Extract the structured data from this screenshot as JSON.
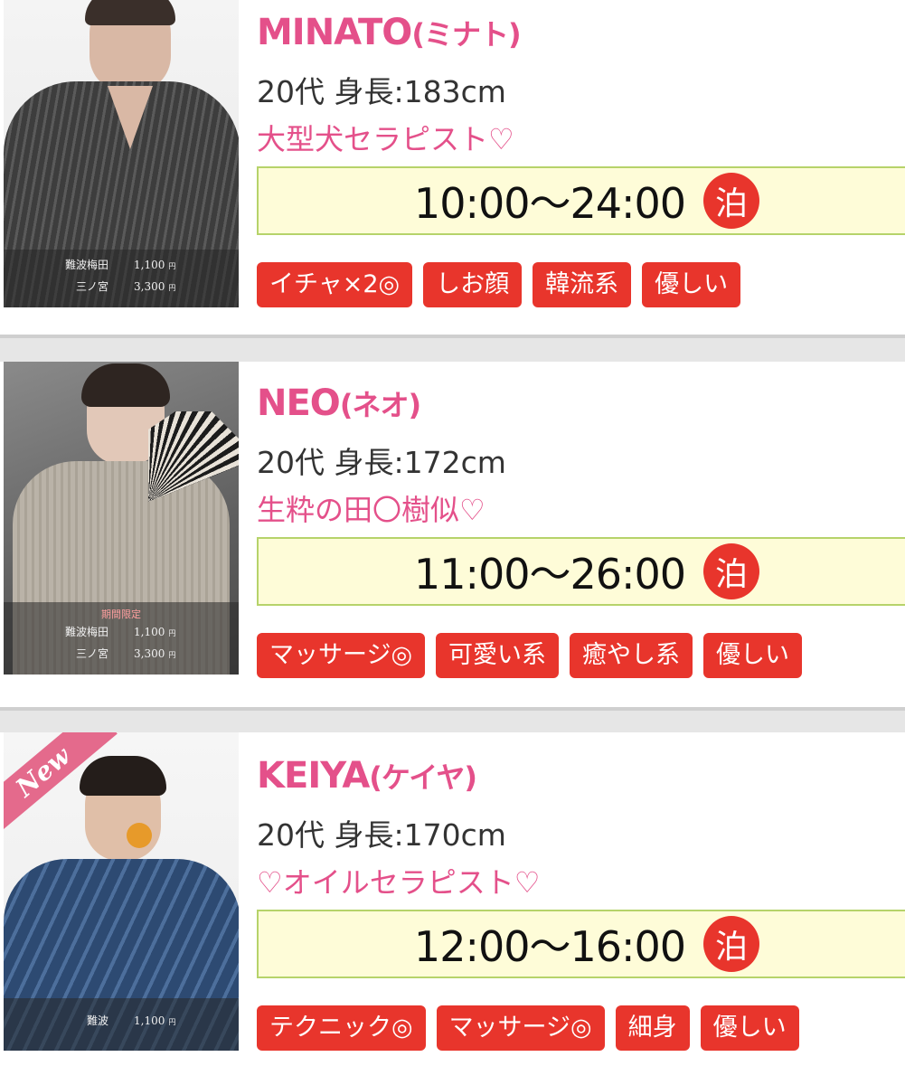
{
  "therapists": [
    {
      "name_en": "MINATO",
      "name_kana": "(ミナト)",
      "age_height": "20代 身長:183cm",
      "catchphrase": "大型犬セラピスト♡",
      "hours": "10:00〜24:00",
      "stay_badge": "泊",
      "tags": [
        "イチャ×2◎",
        "しお顔",
        "韓流系",
        "優しい"
      ],
      "limited": "",
      "prices": [
        {
          "area": "難波梅田",
          "amount": "1,100",
          "unit": "円"
        },
        {
          "area": "三ノ宮",
          "amount": "3,300",
          "unit": "円"
        }
      ],
      "new_ribbon": ""
    },
    {
      "name_en": "NEO",
      "name_kana": "(ネオ)",
      "age_height": "20代 身長:172cm",
      "catchphrase": "生粋の田〇樹似♡",
      "hours": "11:00〜26:00",
      "stay_badge": "泊",
      "tags": [
        "マッサージ◎",
        "可愛い系",
        "癒やし系",
        "優しい"
      ],
      "limited": "期間限定",
      "prices": [
        {
          "area": "難波梅田",
          "amount": "1,100",
          "unit": "円"
        },
        {
          "area": "三ノ宮",
          "amount": "3,300",
          "unit": "円"
        }
      ],
      "new_ribbon": ""
    },
    {
      "name_en": "KEIYA",
      "name_kana": "(ケイヤ)",
      "age_height": "20代 身長:170cm",
      "catchphrase": "♡オイルセラピスト♡",
      "hours": "12:00〜16:00",
      "stay_badge": "泊",
      "tags": [
        "テクニック◎",
        "マッサージ◎",
        "細身",
        "優しい"
      ],
      "limited": "",
      "prices": [
        {
          "area": "難波",
          "amount": "1,100",
          "unit": "円"
        }
      ],
      "new_ribbon": "New"
    }
  ],
  "colors": {
    "name_pink": "#e4508a",
    "tag_red": "#e8352c",
    "hours_bg": "#fefcd8",
    "hours_border": "#b6d36a"
  }
}
